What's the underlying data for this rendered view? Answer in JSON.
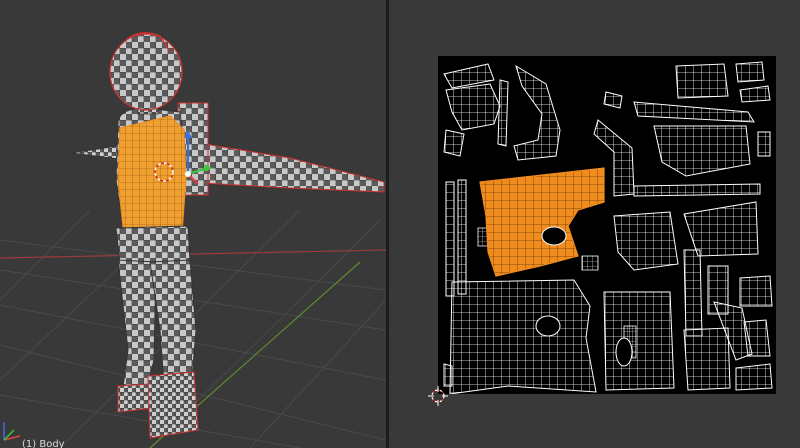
{
  "viewport_3d": {
    "object_label": "(1) Body",
    "colors": {
      "background": "#393939",
      "grid": "#4a4a4a",
      "x_axis": "#9a3b3b",
      "y_axis": "#5e8a2e",
      "mesh_light": "#c8c8c8",
      "mesh_dark": "#5a5a5a",
      "selection": "#f08c1e",
      "seam": "#d03030"
    },
    "icons": [
      "axis-gizmo-icon",
      "3d-cursor-icon",
      "transform-manipulator-icon"
    ]
  },
  "uv_editor": {
    "colors": {
      "background": "#393939",
      "texture_bg": "#000000",
      "wire": "#ffffff",
      "selected_island": "#f08c1e"
    },
    "icons": [
      "2d-cursor-icon"
    ]
  }
}
